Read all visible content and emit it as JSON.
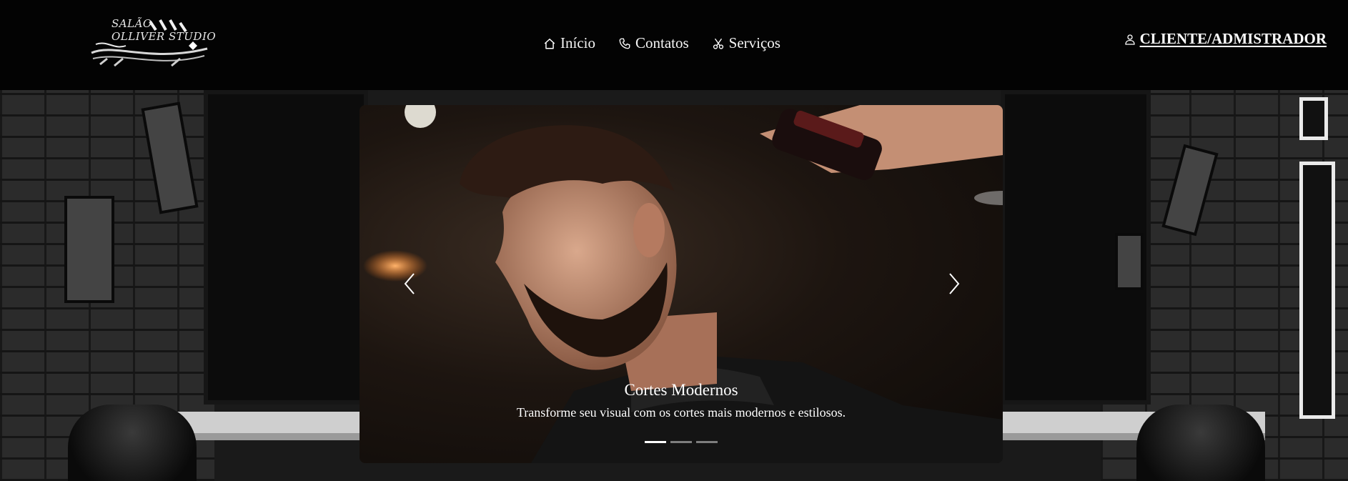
{
  "brand": {
    "line1": "SALÃO",
    "line2": "OLLIVER STUDIO"
  },
  "nav": {
    "items": [
      {
        "label": "Início",
        "icon": "home-icon"
      },
      {
        "label": "Contatos",
        "icon": "phone-icon"
      },
      {
        "label": "Serviços",
        "icon": "scissors-icon"
      }
    ]
  },
  "account": {
    "label": "CLIENTE/ADMISTRADOR",
    "icon": "user-icon"
  },
  "carousel": {
    "title": "Cortes Modernos",
    "subtitle": "Transforme seu visual com os cortes mais modernos e estilosos.",
    "slides_count": 3,
    "active_slide": 1,
    "prev_icon": "chevron-left-icon",
    "next_icon": "chevron-right-icon"
  },
  "colors": {
    "header_bg": "#030303",
    "text": "#ffffff"
  }
}
